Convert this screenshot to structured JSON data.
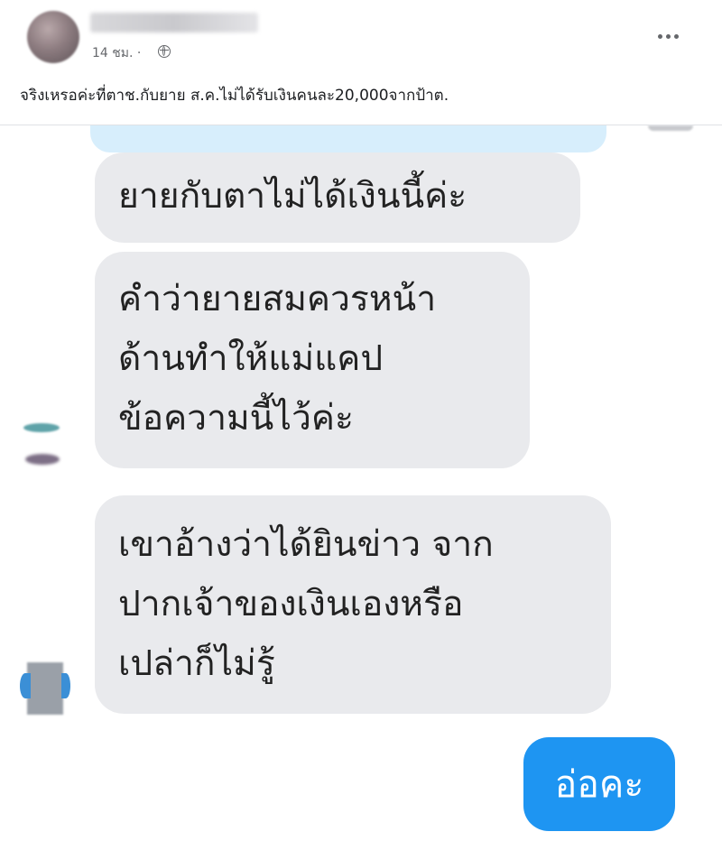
{
  "post": {
    "timestamp": "14 ชม. ·",
    "privacy_icon": "globe-icon",
    "caption": "จริงเหรอค่ะที่ตาช.กับยาย ส.ค.ไม่ได้รับเงินคนละ20,000จากป้าต."
  },
  "chat": {
    "received": [
      {
        "lines": [
          "ยายกับตาไม่ได้เงินนี้ค่ะ"
        ]
      },
      {
        "lines": [
          "คำว่ายายสมควรหน้า",
          "ด้านทำให้แม่แคป",
          "ข้อความนี้ไว้ค่ะ"
        ]
      },
      {
        "lines": [
          "เขาอ้างว่าได้ยินข่าว จาก",
          "ปากเจ้าของเงินเองหรือ",
          "เปล่าก็ไม่รู้"
        ]
      }
    ],
    "sent": {
      "text": "อ่อคะ"
    }
  },
  "colors": {
    "received_bubble": "#e9eaed",
    "sent_bubble": "#1e95f2",
    "partial_bubble": "#d7eefc"
  }
}
